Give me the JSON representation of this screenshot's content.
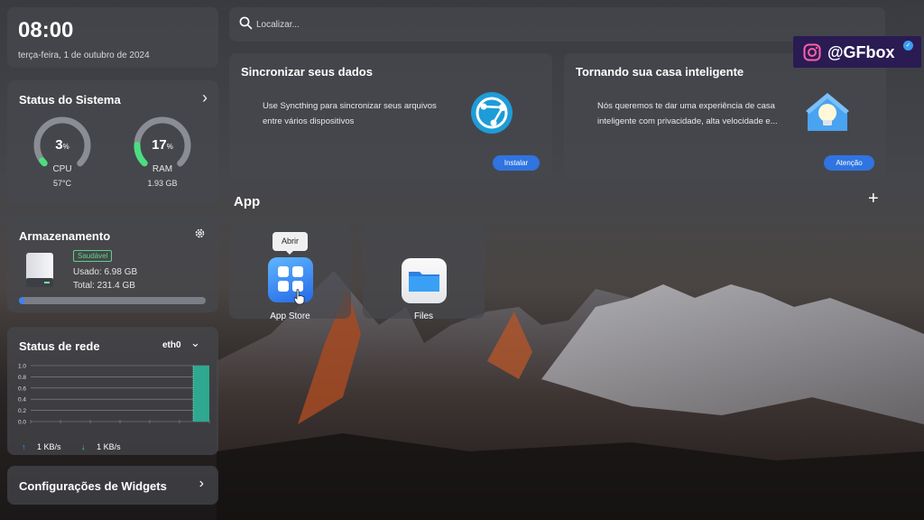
{
  "clock": {
    "time": "08:00",
    "date": "terça-feira, 1 de outubro de 2024"
  },
  "system_status": {
    "title": "Status do Sistema",
    "cpu": {
      "value": "3",
      "unit": "%",
      "label": "CPU",
      "detail": "57°C",
      "fraction": 0.03
    },
    "ram": {
      "value": "17",
      "unit": "%",
      "label": "RAM",
      "detail": "1.93 GB",
      "fraction": 0.17
    }
  },
  "storage": {
    "title": "Armazenamento",
    "badge": "Saudável",
    "used": "Usado: 6.98 GB",
    "total": "Total: 231.4 GB",
    "used_fraction": 0.03
  },
  "network": {
    "title": "Status de rede",
    "interface": "eth0",
    "y_ticks": [
      "1.0",
      "0.8",
      "0.6",
      "0.4",
      "0.2",
      "0.0"
    ],
    "upload": "1 KB/s",
    "download": "1 KB/s",
    "accent": "#2ea88f"
  },
  "widgets": {
    "label": "Configurações de Widgets"
  },
  "search": {
    "placeholder": "Localizar..."
  },
  "cards": {
    "sync": {
      "title": "Sincronizar seus dados",
      "description": "Use Syncthing para sincronizar seus arquivos entre vários dispositivos",
      "button": "Instalar"
    },
    "home": {
      "title": "Tornando sua casa inteligente",
      "description": "Nós queremos te dar uma experiência de casa inteligente com privacidade, alta velocidade e...",
      "button": "Atenção"
    }
  },
  "apps": {
    "heading": "App",
    "add": "+",
    "tooltip": "Abrir",
    "items": [
      {
        "label": "App Store",
        "icon": "app-store-icon"
      },
      {
        "label": "Files",
        "icon": "folder-icon"
      }
    ]
  },
  "watermark": {
    "handle": "@GFbox"
  },
  "colors": {
    "accent_blue": "#2f74e0",
    "gauge_green": "#4ade80",
    "badge_green": "#5bd48a"
  }
}
